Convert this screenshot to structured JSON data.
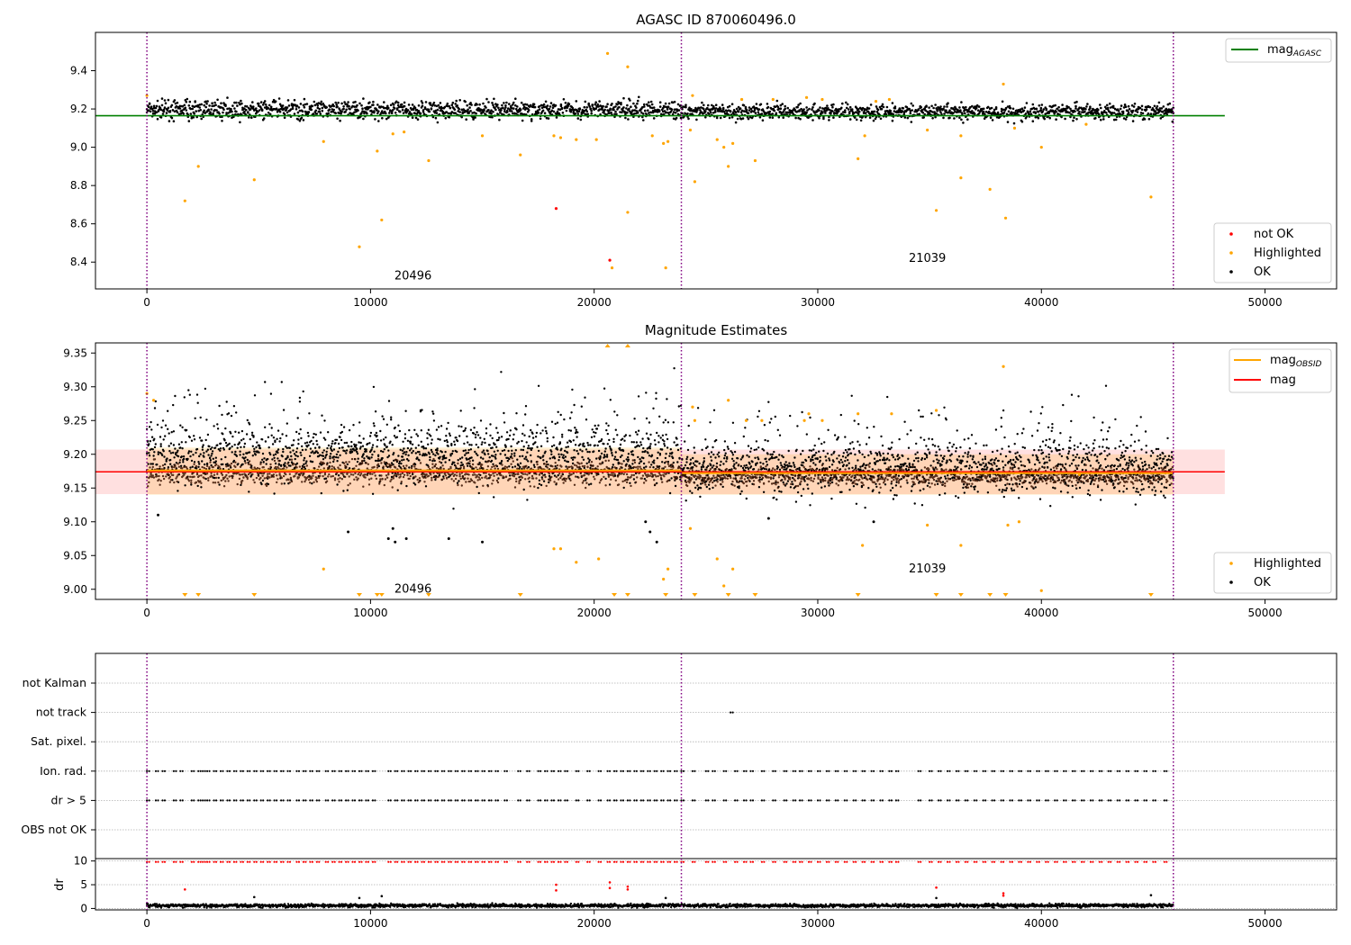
{
  "chart_data": [
    {
      "type": "scatter",
      "title": "AGASC ID 870060496.0",
      "xlim": [
        -2300,
        53200
      ],
      "ylim": [
        8.26,
        9.6
      ],
      "xticks": [
        0,
        10000,
        20000,
        30000,
        40000,
        50000
      ],
      "yticks": [
        8.4,
        8.6,
        8.8,
        9.0,
        9.2,
        9.4
      ],
      "grid": false,
      "legend_top": {
        "placement": "top-right",
        "entries": [
          {
            "label": "mag",
            "subscript": "AGASC",
            "color": "#008000"
          }
        ]
      },
      "legend_bottom": {
        "placement": "bottom-right",
        "entries": [
          {
            "label": "not OK",
            "color": "#ff0000"
          },
          {
            "label": "Highlighted",
            "color": "#ffa500"
          },
          {
            "label": "OK",
            "color": "#000000"
          }
        ]
      },
      "obsid_boundaries": [
        0,
        23900,
        45900
      ],
      "obsid_labels": [
        {
          "text": "20496",
          "x": 11900,
          "y": 8.31
        },
        {
          "text": "21039",
          "x": 34900,
          "y": 8.4
        }
      ],
      "reference_line": {
        "name": "mag_AGASC",
        "y": 9.165,
        "x": [
          -2300,
          48200
        ]
      },
      "ok_band": [
        {
          "x": [
            0,
            23900
          ],
          "y": [
            9.12,
            9.27
          ]
        },
        {
          "x": [
            23900,
            45900
          ],
          "y": [
            9.12,
            9.25
          ]
        }
      ],
      "highlighted_points": [
        [
          0,
          9.27
        ],
        [
          1700,
          8.72
        ],
        [
          2300,
          8.9
        ],
        [
          4800,
          8.83
        ],
        [
          7900,
          9.03
        ],
        [
          9500,
          8.48
        ],
        [
          10300,
          8.98
        ],
        [
          10500,
          8.62
        ],
        [
          11000,
          9.07
        ],
        [
          11500,
          9.08
        ],
        [
          12600,
          8.93
        ],
        [
          15000,
          9.06
        ],
        [
          16700,
          8.96
        ],
        [
          18200,
          9.06
        ],
        [
          18500,
          9.05
        ],
        [
          19200,
          9.04
        ],
        [
          20100,
          9.04
        ],
        [
          20600,
          9.49
        ],
        [
          20800,
          8.37
        ],
        [
          21500,
          9.42
        ],
        [
          21500,
          8.66
        ],
        [
          22600,
          9.06
        ],
        [
          23100,
          9.02
        ],
        [
          23200,
          8.37
        ],
        [
          23300,
          9.03
        ],
        [
          24300,
          9.09
        ],
        [
          24500,
          8.82
        ],
        [
          24400,
          9.27
        ],
        [
          25500,
          9.04
        ],
        [
          25800,
          9.0
        ],
        [
          26000,
          8.9
        ],
        [
          26200,
          9.02
        ],
        [
          26600,
          9.25
        ],
        [
          27200,
          8.93
        ],
        [
          28000,
          9.25
        ],
        [
          29500,
          9.26
        ],
        [
          30200,
          9.25
        ],
        [
          31800,
          8.94
        ],
        [
          32100,
          9.06
        ],
        [
          32600,
          9.24
        ],
        [
          33200,
          9.25
        ],
        [
          34900,
          9.09
        ],
        [
          35300,
          8.67
        ],
        [
          36400,
          9.06
        ],
        [
          36400,
          8.84
        ],
        [
          37700,
          8.78
        ],
        [
          38300,
          9.33
        ],
        [
          38400,
          8.63
        ],
        [
          38800,
          9.1
        ],
        [
          40000,
          9.0
        ],
        [
          42000,
          9.12
        ],
        [
          44900,
          8.74
        ]
      ],
      "not_ok_points": [
        [
          18300,
          8.68
        ],
        [
          20700,
          8.41
        ]
      ]
    },
    {
      "type": "scatter",
      "title": "Magnitude Estimates",
      "xlim": [
        -2300,
        53200
      ],
      "ylim": [
        8.985,
        9.365
      ],
      "xticks": [
        0,
        10000,
        20000,
        30000,
        40000,
        50000
      ],
      "yticks": [
        9.0,
        9.05,
        9.1,
        9.15,
        9.2,
        9.25,
        9.3,
        9.35
      ],
      "grid": false,
      "legend_top": {
        "placement": "top-right",
        "entries": [
          {
            "label": "mag",
            "subscript": "OBSID",
            "color": "#ffa500"
          },
          {
            "label": "mag",
            "subscript": "",
            "color": "#ff0000"
          }
        ]
      },
      "legend_bottom": {
        "placement": "bottom-right",
        "entries": [
          {
            "label": "Highlighted",
            "color": "#ffa500"
          },
          {
            "label": "OK",
            "color": "#000000"
          }
        ]
      },
      "obsid_boundaries": [
        0,
        23900,
        45900
      ],
      "obsid_labels": [
        {
          "text": "20496",
          "x": 11900,
          "y": 8.995
        },
        {
          "text": "21039",
          "x": 34900,
          "y": 9.025
        }
      ],
      "mag_line": {
        "y": 9.174,
        "x": [
          -2300,
          48200
        ]
      },
      "mag_band": {
        "y": [
          9.141,
          9.207
        ],
        "x": [
          -2300,
          48200
        ]
      },
      "mag_obsid": [
        {
          "x": [
            0,
            23900
          ],
          "y": 9.176,
          "band": [
            9.14,
            9.21
          ]
        },
        {
          "x": [
            23900,
            45900
          ],
          "y": 9.172,
          "band": [
            9.14,
            9.2
          ]
        }
      ],
      "ok_band": [
        {
          "x": [
            0,
            23900
          ],
          "y": [
            9.13,
            9.27
          ]
        },
        {
          "x": [
            23900,
            45900
          ],
          "y": [
            9.12,
            9.24
          ]
        }
      ],
      "highlighted_points": [
        [
          0,
          9.29
        ],
        [
          300,
          9.28
        ],
        [
          7900,
          9.03
        ],
        [
          18200,
          9.06
        ],
        [
          18500,
          9.06
        ],
        [
          19200,
          9.04
        ],
        [
          20200,
          9.045
        ],
        [
          23100,
          9.015
        ],
        [
          23300,
          9.03
        ],
        [
          24300,
          9.09
        ],
        [
          24400,
          9.27
        ],
        [
          24500,
          9.25
        ],
        [
          25500,
          9.045
        ],
        [
          25800,
          9.005
        ],
        [
          26000,
          9.28
        ],
        [
          26200,
          9.03
        ],
        [
          26800,
          9.25
        ],
        [
          27500,
          9.25
        ],
        [
          29400,
          9.25
        ],
        [
          29600,
          9.26
        ],
        [
          30200,
          9.25
        ],
        [
          31800,
          9.26
        ],
        [
          32000,
          9.065
        ],
        [
          33300,
          9.26
        ],
        [
          34900,
          9.095
        ],
        [
          35300,
          9.265
        ],
        [
          36400,
          9.065
        ],
        [
          38300,
          9.33
        ],
        [
          38500,
          9.095
        ],
        [
          39000,
          9.1
        ],
        [
          40000,
          8.998
        ],
        [
          41700,
          9.17
        ]
      ],
      "ok_outliers": [
        [
          500,
          9.11
        ],
        [
          9000,
          9.085
        ],
        [
          10800,
          9.075
        ],
        [
          11000,
          9.09
        ],
        [
          11100,
          9.07
        ],
        [
          11600,
          9.075
        ],
        [
          13500,
          9.075
        ],
        [
          15000,
          9.07
        ],
        [
          22300,
          9.1
        ],
        [
          22500,
          9.085
        ],
        [
          22800,
          9.07
        ],
        [
          27800,
          9.105
        ],
        [
          32500,
          9.1
        ]
      ],
      "below_range_markers": [
        1700,
        2300,
        4800,
        9500,
        10300,
        10500,
        12600,
        16700,
        20900,
        21500,
        23200,
        24500,
        26000,
        27200,
        31800,
        35300,
        36400,
        37700,
        38400,
        44900
      ],
      "above_range_markers": [
        20600,
        21500
      ]
    },
    {
      "type": "scatter",
      "title": "",
      "xlim": [
        -2300,
        53200
      ],
      "xticks": [
        0,
        10000,
        20000,
        30000,
        40000,
        50000
      ],
      "categories": [
        "not Kalman",
        "not track",
        "Sat. pixel.",
        "Ion. rad.",
        "dr > 5",
        "OBS not OK"
      ],
      "grid": true,
      "obsid_boundaries": [
        0,
        23900,
        45900
      ],
      "flag_points": {
        "not track": [
          26100
        ],
        "Ion. rad.": [
          0,
          400,
          700,
          1200,
          1500,
          2000,
          2300,
          2500,
          2700,
          3000,
          3300,
          3600,
          3900,
          4200,
          4500,
          4800,
          5100,
          5400,
          5700,
          6000,
          6300,
          6700,
          7000,
          7300,
          7600,
          8000,
          8300,
          8600,
          8900,
          9200,
          9500,
          9800,
          10100,
          10800,
          11100,
          11400,
          11700,
          12000,
          12300,
          12600,
          12900,
          13200,
          13500,
          13800,
          14100,
          14400,
          14700,
          15000,
          15300,
          15600,
          16000,
          16600,
          17000,
          17500,
          17800,
          18100,
          18400,
          18700,
          19200,
          19700,
          20200,
          20600,
          20900,
          21200,
          21500,
          21800,
          22100,
          22400,
          22700,
          23000,
          23300,
          23600,
          23900,
          24400,
          25000,
          25300,
          25800,
          26300,
          26700,
          27000,
          27500,
          28000,
          28500,
          28900,
          29200,
          29600,
          30000,
          30400,
          30800,
          31200,
          31600,
          32000,
          32400,
          32800,
          33200,
          33500,
          34500,
          35000,
          35400,
          35800,
          36200,
          36600,
          37000,
          37400,
          37800,
          38200,
          38600,
          39000,
          39400,
          39800,
          40200,
          40600,
          41000,
          41400,
          41800,
          42200,
          42600,
          43000,
          43400,
          43800,
          44200,
          44600,
          45000,
          45500
        ],
        "dr > 5": [
          0,
          400,
          700,
          1200,
          1500,
          2000,
          2300,
          2500,
          2700,
          3000,
          3300,
          3600,
          3900,
          4200,
          4500,
          4800,
          5100,
          5400,
          5700,
          6000,
          6300,
          6700,
          7000,
          7300,
          7600,
          8000,
          8300,
          8600,
          8900,
          9200,
          9500,
          9800,
          10100,
          10800,
          11100,
          11400,
          11700,
          12000,
          12300,
          12600,
          12900,
          13200,
          13500,
          13800,
          14100,
          14400,
          14700,
          15000,
          15300,
          15600,
          16000,
          16600,
          17000,
          17500,
          17800,
          18100,
          18400,
          18700,
          19200,
          19700,
          20200,
          20600,
          20900,
          21200,
          21500,
          21800,
          22100,
          22400,
          22700,
          23000,
          23300,
          23600,
          23900,
          24400,
          25000,
          25300,
          25800,
          26300,
          26700,
          27000,
          27500,
          28000,
          28500,
          28900,
          29200,
          29600,
          30000,
          30400,
          30800,
          31200,
          31600,
          32000,
          32400,
          32800,
          33200,
          33500,
          34500,
          35000,
          35400,
          35800,
          36200,
          36600,
          37000,
          37400,
          37800,
          38200,
          38600,
          39000,
          39400,
          39800,
          40200,
          40600,
          41000,
          41400,
          41800,
          42200,
          42600,
          43000,
          43400,
          43800,
          44200,
          44600,
          45000,
          45500
        ]
      }
    },
    {
      "type": "scatter",
      "title": "",
      "xlim": [
        -2300,
        53200
      ],
      "ylim": [
        -0.3,
        10.5
      ],
      "xticks": [
        0,
        10000,
        20000,
        30000,
        40000,
        50000
      ],
      "yticks": [
        0,
        5,
        10
      ],
      "ylabel": "dr",
      "grid": true,
      "obsid_boundaries": [
        0,
        23900,
        45900
      ],
      "ok_band": {
        "x": [
          0,
          45900
        ],
        "y": [
          0,
          1.2
        ]
      },
      "clipped_points": [
        0,
        400,
        700,
        1200,
        1500,
        2000,
        2300,
        2500,
        2700,
        3000,
        3300,
        3600,
        3900,
        4200,
        4500,
        4800,
        5100,
        5400,
        5700,
        6000,
        6300,
        6700,
        7000,
        7300,
        7600,
        8000,
        8300,
        8600,
        8900,
        9200,
        9500,
        9800,
        10100,
        10800,
        11100,
        11400,
        11700,
        12000,
        12300,
        12600,
        12900,
        13200,
        13500,
        13800,
        14100,
        14400,
        14700,
        15000,
        15300,
        15600,
        16000,
        16600,
        17000,
        17500,
        17800,
        18100,
        18400,
        18700,
        19200,
        19700,
        20200,
        20600,
        20900,
        21200,
        21500,
        21800,
        22100,
        22400,
        22700,
        23000,
        23300,
        23600,
        23900,
        24400,
        25000,
        25300,
        25800,
        26300,
        26700,
        27000,
        27500,
        28000,
        28500,
        28900,
        29200,
        29600,
        30000,
        30400,
        30800,
        31200,
        31600,
        32000,
        32400,
        32800,
        33200,
        33500,
        34500,
        35000,
        35400,
        35800,
        36200,
        36600,
        37000,
        37400,
        37800,
        38200,
        38600,
        39000,
        39400,
        39800,
        40200,
        40600,
        41000,
        41400,
        41800,
        42200,
        42600,
        43000,
        43400,
        43800,
        44200,
        44600,
        45000,
        45500
      ],
      "not_ok_points": [
        [
          1700,
          4.0
        ],
        [
          18300,
          5.0
        ],
        [
          18300,
          3.8
        ],
        [
          20700,
          5.5
        ],
        [
          20700,
          4.3
        ],
        [
          21500,
          4.0
        ],
        [
          21500,
          4.6
        ],
        [
          35300,
          4.4
        ],
        [
          38300,
          3.2
        ],
        [
          38300,
          2.7
        ]
      ],
      "ok_outliers": [
        [
          4800,
          2.4
        ],
        [
          9500,
          2.2
        ],
        [
          10500,
          2.6
        ],
        [
          23200,
          2.2
        ],
        [
          35300,
          2.2
        ],
        [
          44900,
          2.8
        ]
      ]
    }
  ]
}
